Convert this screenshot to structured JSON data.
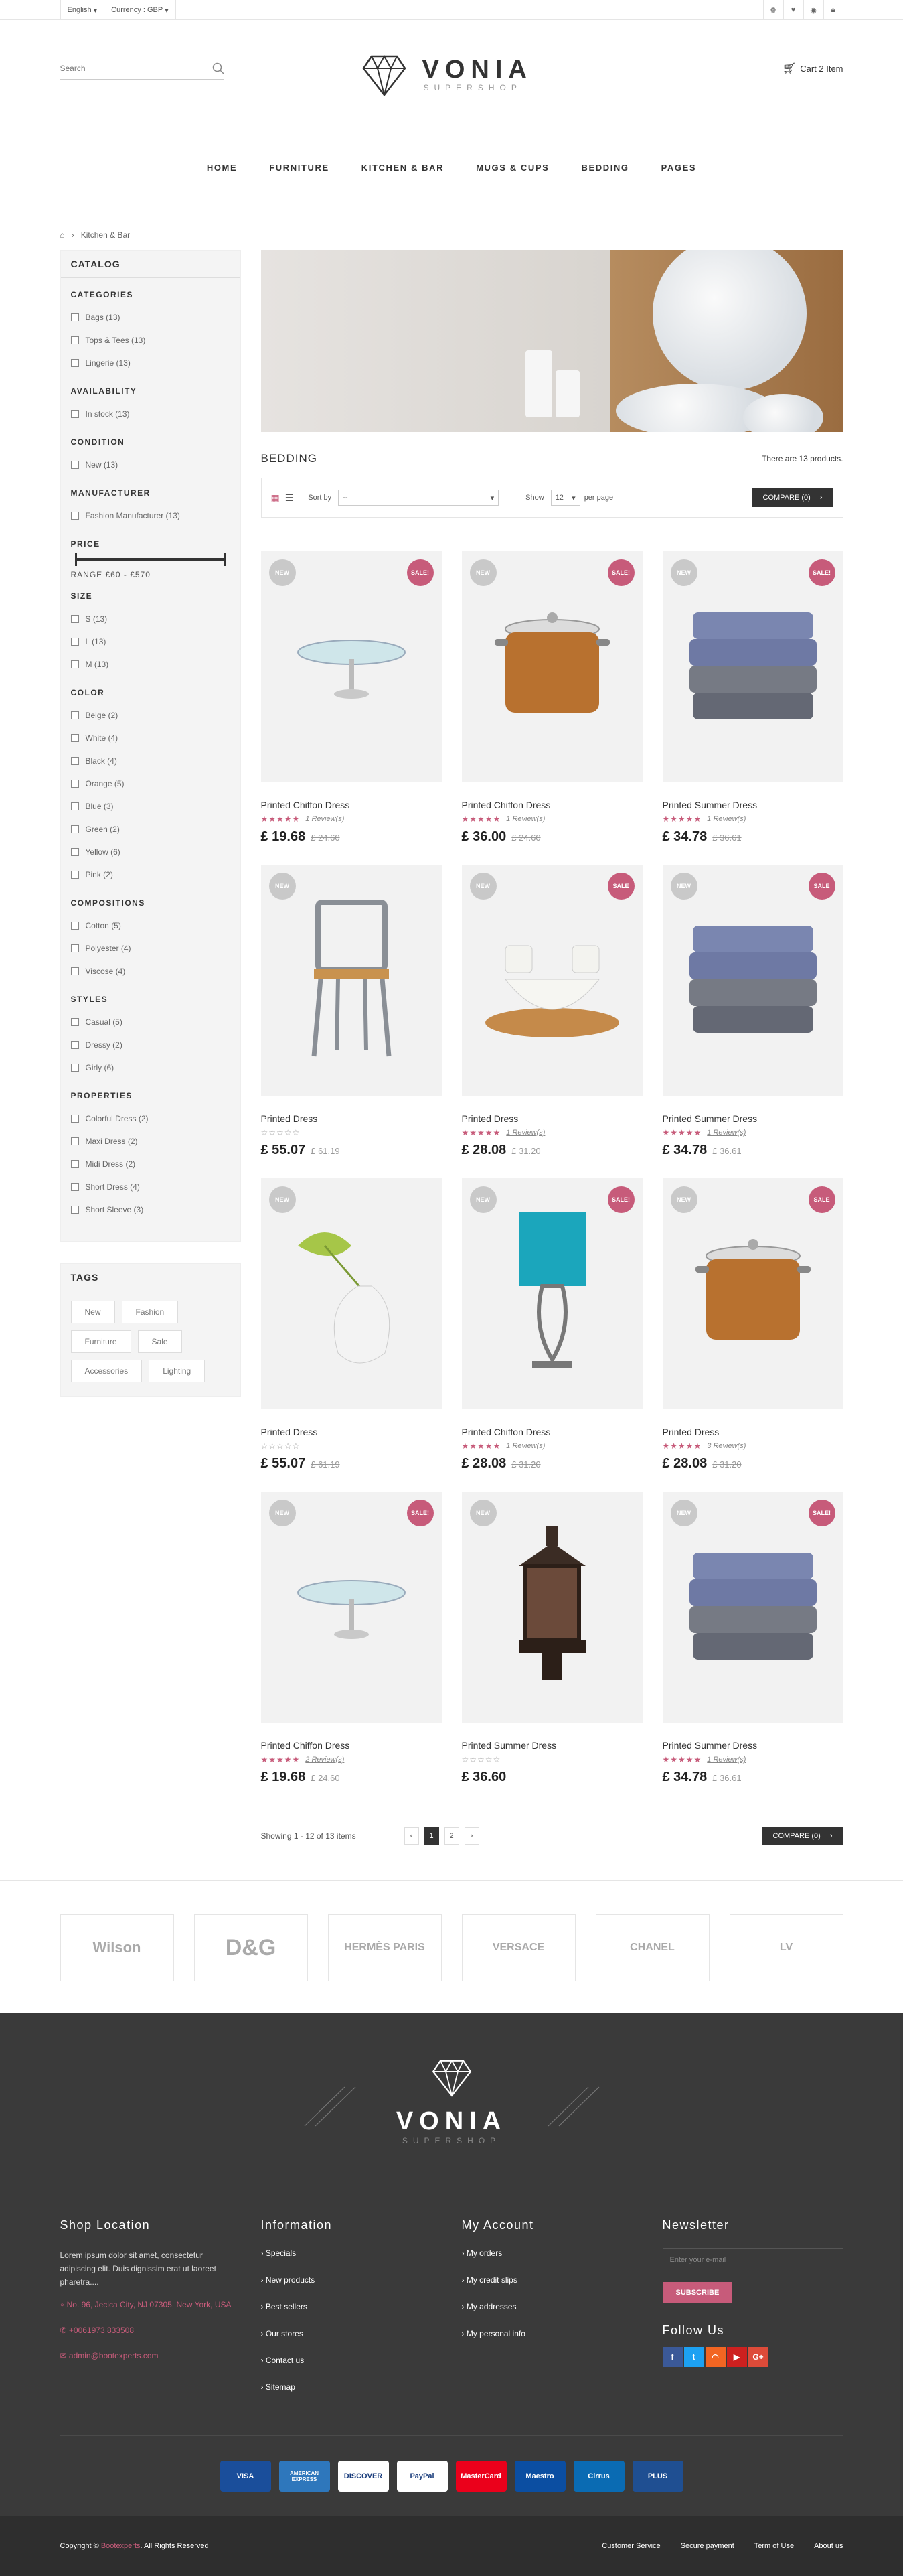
{
  "topbar": {
    "language": "English",
    "currency": "Currency : GBP"
  },
  "header": {
    "search_placeholder": "Search",
    "logo_name": "VONIA",
    "logo_sub": "SUPERSHOP",
    "cart": "Cart 2 Item"
  },
  "nav": [
    "HOME",
    "FURNITURE",
    "KITCHEN & BAR",
    "MUGS & CUPS",
    "BEDDING",
    "PAGES"
  ],
  "breadcrumb": {
    "current": "Kitchen & Bar"
  },
  "sidebar": {
    "title": "CATALOG",
    "sections": [
      {
        "title": "CATEGORIES",
        "items": [
          "Bags (13)",
          "Tops & Tees (13)",
          "Lingerie (13)"
        ]
      },
      {
        "title": "AVAILABILITY",
        "items": [
          "In stock (13)"
        ]
      },
      {
        "title": "CONDITION",
        "items": [
          "New (13)"
        ]
      },
      {
        "title": "MANUFACTURER",
        "items": [
          "Fashion Manufacturer (13)"
        ]
      }
    ],
    "price_title": "PRICE",
    "price_range": "RANGE  £60 - £570",
    "sections2": [
      {
        "title": "SIZE",
        "items": [
          "S (13)",
          "L (13)",
          "M (13)"
        ]
      },
      {
        "title": "COLOR",
        "items": [
          "Beige (2)",
          "White (4)",
          "Black (4)",
          "Orange (5)",
          "Blue (3)",
          "Green (2)",
          "Yellow (6)",
          "Pink (2)"
        ]
      },
      {
        "title": "COMPOSITIONS",
        "items": [
          "Cotton (5)",
          "Polyester (4)",
          "Viscose (4)"
        ]
      },
      {
        "title": "STYLES",
        "items": [
          "Casual (5)",
          "Dressy (2)",
          "Girly (6)"
        ]
      },
      {
        "title": "PROPERTIES",
        "items": [
          "Colorful Dress (2)",
          "Maxi Dress (2)",
          "Midi Dress (2)",
          "Short Dress (4)",
          "Short Sleeve (3)"
        ]
      }
    ],
    "tags_title": "TAGS",
    "tags": [
      "New",
      "Fashion",
      "Furniture",
      "Sale",
      "Accessories",
      "Lighting"
    ]
  },
  "category": {
    "title": "BEDDING",
    "count": "There are 13 products."
  },
  "toolbar": {
    "sort_label": "Sort by",
    "sort_value": "--",
    "show_label": "Show",
    "show_value": "12",
    "per_page": "per page",
    "compare": "COMPARE (0)"
  },
  "products": [
    {
      "name": "Printed Chiffon Dress",
      "price": "£ 19.68",
      "old": "£ 24.60",
      "stars": "★★★★★",
      "filled": true,
      "reviews": "1 Review(s)",
      "sale": "SALE!",
      "img": "glass-stand"
    },
    {
      "name": "Printed Chiffon Dress",
      "price": "£ 36.00",
      "old": "£ 24.60",
      "stars": "★★★★★",
      "filled": true,
      "reviews": "1 Review(s)",
      "sale": "SALE!",
      "img": "copper-pot"
    },
    {
      "name": "Printed Summer Dress",
      "price": "£ 34.78",
      "old": "£ 36.61",
      "stars": "★★★★★",
      "filled": true,
      "reviews": "1 Review(s)",
      "sale": "SALE!",
      "img": "blankets"
    },
    {
      "name": "Printed Dress",
      "price": "£ 55.07",
      "old": "£ 61.19",
      "stars": "☆☆☆☆☆",
      "filled": false,
      "reviews": "",
      "sale": "",
      "img": "chair"
    },
    {
      "name": "Printed Dress",
      "price": "£ 28.08",
      "old": "£ 31.20",
      "stars": "★★★★★",
      "filled": true,
      "reviews": "1 Review(s)",
      "sale": "SALE",
      "img": "bowls"
    },
    {
      "name": "Printed Summer Dress",
      "price": "£ 34.78",
      "old": "£ 36.61",
      "stars": "★★★★★",
      "filled": true,
      "reviews": "1 Review(s)",
      "sale": "SALE",
      "img": "blankets"
    },
    {
      "name": "Printed Dress",
      "price": "£ 55.07",
      "old": "£ 61.19",
      "stars": "☆☆☆☆☆",
      "filled": false,
      "reviews": "",
      "sale": "",
      "img": "vase"
    },
    {
      "name": "Printed Chiffon Dress",
      "price": "£ 28.08",
      "old": "£ 31.20",
      "stars": "★★★★★",
      "filled": true,
      "reviews": "1 Review(s)",
      "sale": "SALE!",
      "img": "lamp"
    },
    {
      "name": "Printed Dress",
      "price": "£ 28.08",
      "old": "£ 31.20",
      "stars": "★★★★★",
      "filled": true,
      "reviews": "3 Review(s)",
      "sale": "SALE",
      "img": "copper-pot"
    },
    {
      "name": "Printed Chiffon Dress",
      "price": "£ 19.68",
      "old": "£ 24.60",
      "stars": "★★★★★",
      "filled": true,
      "reviews": "2 Review(s)",
      "sale": "SALE!",
      "img": "glass-stand"
    },
    {
      "name": "Printed Summer Dress",
      "price": "£ 36.60",
      "old": "",
      "stars": "☆☆☆☆☆",
      "filled": false,
      "reviews": "",
      "sale": "",
      "img": "lantern"
    },
    {
      "name": "Printed Summer Dress",
      "price": "£ 34.78",
      "old": "£ 36.61",
      "stars": "★★★★★",
      "filled": true,
      "reviews": "1 Review(s)",
      "sale": "SALE!",
      "img": "blankets"
    }
  ],
  "new_badge": "NEW",
  "pager": {
    "showing": "Showing 1 - 12 of 13 items",
    "prev": "‹",
    "pages": [
      "1",
      "2"
    ],
    "next": "›",
    "compare": "COMPARE (0)"
  },
  "brands": [
    "Wilson",
    "D&G",
    "HERMÈS PARIS",
    "VERSACE",
    "CHANEL",
    "LV"
  ],
  "footer": {
    "logo_name": "VONIA",
    "logo_sub": "SUPERSHOP",
    "shop_title": "Shop Location",
    "shop_text": "Lorem ipsum dolor sit amet, consectetur adipiscing elit. Duis dignissim erat ut laoreet pharetra....",
    "address": "No. 96, Jecica City, NJ 07305, New York, USA",
    "phone": "+0061973 833508",
    "email": "admin@bootexperts.com",
    "info_title": "Information",
    "info_links": [
      "Specials",
      "New products",
      "Best sellers",
      "Our stores",
      "Contact us",
      "Sitemap"
    ],
    "account_title": "My Account",
    "account_links": [
      "My orders",
      "My credit slips",
      "My addresses",
      "My personal info"
    ],
    "news_title": "Newsletter",
    "news_placeholder": "Enter your e-mail",
    "news_btn": "SUBSCRIBE",
    "follow_title": "Follow Us",
    "payments": [
      "VISA",
      "AMERICAN EXPRESS",
      "DISCOVER",
      "PayPal",
      "MasterCard",
      "Maestro",
      "Cirrus",
      "PLUS"
    ],
    "copyright": "Copyright ©",
    "copyright_brand": "Bootexperts",
    "copyright_rest": ". All Rights Reserved",
    "bottom_links": [
      "Customer Service",
      "Secure payment",
      "Term of Use",
      "About us"
    ]
  },
  "colors": {
    "accent": "#c75b7a",
    "dark": "#333333",
    "footer": "#3a3a3a"
  }
}
